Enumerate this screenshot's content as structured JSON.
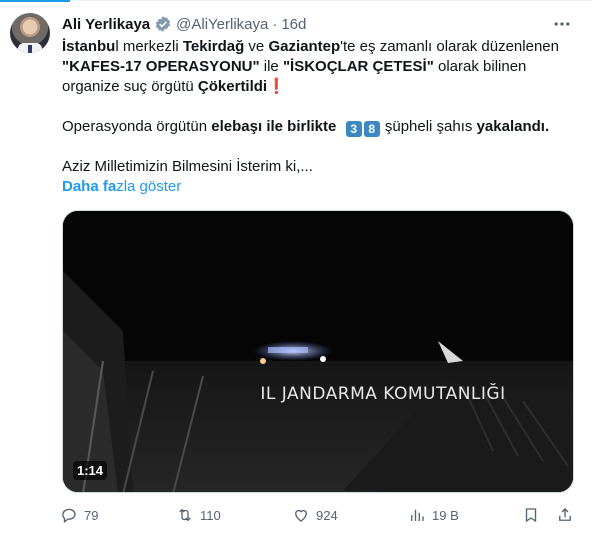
{
  "tweet": {
    "author_name": "Ali Yerlikaya",
    "handle": "@AliYerlikaya",
    "separator": "·",
    "time": "16d",
    "lines": {
      "l1_a": "İstanbu",
      "l1_b": "l merkezli ",
      "l1_c": "Tekirdağ",
      "l1_d": " ve ",
      "l1_e": "Gaziantep",
      "l1_f": "'te eş zamanlı olarak düzenlenen",
      "l2_a": "\"KAFES-17 OPERASYONU\"",
      "l2_b": " ile ",
      "l2_c": "\"İSKOÇLAR ÇETESİ\"",
      "l2_d": " olarak bilinen",
      "l3_a": "organize suç örgütü ",
      "l3_b": "Çökertildi",
      "l3_c": "❗",
      "l5_a": "Operasyonda örgütün ",
      "l5_b": "elebaşı ile birlikte",
      "l5_badge1": "3",
      "l5_badge2": "8",
      "l5_c": " şüpheli şahıs ",
      "l5_d": "yakalandı.",
      "l7": "Aziz Milletimizin Bilmesini İsterim ki,..."
    },
    "show_more_bold": "Daha fa",
    "show_more_rest": "zla göster"
  },
  "media": {
    "duration": "1:14",
    "sign_text": "IL JANDARMA KOMUTANLIĞI"
  },
  "actions": {
    "replies": "79",
    "reposts": "110",
    "likes": "924",
    "views": "19 B"
  },
  "colors": {
    "accent": "#1d9bf0",
    "muted": "#536471",
    "badge": "#3b88c3"
  },
  "icons": [
    "verified-icon",
    "more-icon",
    "reply-icon",
    "repost-icon",
    "like-icon",
    "views-icon",
    "bookmark-icon",
    "share-icon"
  ]
}
